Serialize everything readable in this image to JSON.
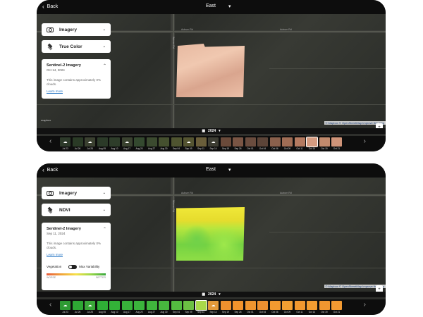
{
  "panels": [
    {
      "back_label": "Back",
      "field_name": "East",
      "imagery_label": "Imagery",
      "layer_label": "True Color",
      "info": {
        "title": "Sentinel-2 Imagery",
        "date": "Oct 14, 2024",
        "message": "This image contains approximately 0% clouds.",
        "link": "Learn more"
      },
      "road_labels": {
        "v": "Warren Rd",
        "h": "Auburn Rd",
        "h2": "Auburn Rd"
      },
      "mapbox": "mapbox",
      "attribution": "© Mapbox © OpenStreetMap Improve this map",
      "year": "2024",
      "timeline": [
        {
          "label": "Jul 23",
          "color": "#2d3a2a",
          "icon": "cloud"
        },
        {
          "label": "Jul 26",
          "color": "#2a3a26",
          "icon": ""
        },
        {
          "label": "Jul 28",
          "color": "#3a4030",
          "icon": "cloud"
        },
        {
          "label": "Aug 05",
          "color": "#2b3a28",
          "icon": ""
        },
        {
          "label": "Aug 10",
          "color": "#2e3d2a",
          "icon": ""
        },
        {
          "label": "Aug 17",
          "color": "#3a4230",
          "icon": "cloud"
        },
        {
          "label": "Aug 20",
          "color": "#34492f",
          "icon": ""
        },
        {
          "label": "Aug 27",
          "color": "#3b4a2f",
          "icon": ""
        },
        {
          "label": "Aug 30",
          "color": "#45502f",
          "icon": ""
        },
        {
          "label": "Sep 04",
          "color": "#4f5430",
          "icon": ""
        },
        {
          "label": "Sep 09",
          "color": "#545431",
          "icon": "cloud"
        },
        {
          "label": "Sep 11",
          "color": "#6a5e3a",
          "icon": ""
        },
        {
          "label": "Sep 14",
          "color": "#3d3d33",
          "icon": "cloud"
        },
        {
          "label": "Sep 19",
          "color": "#6a4a3a",
          "icon": ""
        },
        {
          "label": "Sep 26",
          "color": "#7a5544",
          "icon": ""
        },
        {
          "label": "Oct 01",
          "color": "#6a4c3e",
          "icon": ""
        },
        {
          "label": "Oct 04",
          "color": "#5c4438",
          "icon": ""
        },
        {
          "label": "Oct 06",
          "color": "#8a604c",
          "icon": ""
        },
        {
          "label": "Oct 09",
          "color": "#a06d55",
          "icon": ""
        },
        {
          "label": "Oct 11",
          "color": "#b47a60",
          "icon": ""
        },
        {
          "label": "Oct 14",
          "color": "#d49b80",
          "icon": ""
        },
        {
          "label": "Oct 19",
          "color": "#c18a6d",
          "icon": ""
        },
        {
          "label": "Oct 21",
          "color": "#cf9479",
          "icon": ""
        }
      ],
      "selected": 20
    },
    {
      "back_label": "Back",
      "field_name": "East",
      "imagery_label": "Imagery",
      "layer_label": "NDVI",
      "info": {
        "title": "Sentinel-2 Imagery",
        "date": "Sep 11, 2024",
        "message": "This image contains approximately 0% clouds.",
        "link": "Learn more"
      },
      "vegetation": {
        "label": "Vegetation",
        "toggle_label": "Max Variability",
        "worse": "WORSE",
        "better": "BETTER"
      },
      "road_labels": {
        "v": "Warren Rd",
        "h": "Auburn Rd",
        "h2": "Auburn Rd"
      },
      "mapbox": "mapbox",
      "attribution": "© Mapbox © OpenStreetMap Improve this map",
      "year": "2024",
      "timeline": [
        {
          "label": "Jul 23",
          "color": "#2e9a33",
          "icon": "cloud"
        },
        {
          "label": "Jul 26",
          "color": "#2ea834",
          "icon": ""
        },
        {
          "label": "Jul 28",
          "color": "#3aa838",
          "icon": "cloud"
        },
        {
          "label": "Aug 05",
          "color": "#2fae36",
          "icon": ""
        },
        {
          "label": "Aug 10",
          "color": "#33b238",
          "icon": ""
        },
        {
          "label": "Aug 17",
          "color": "#38b23a",
          "icon": ""
        },
        {
          "label": "Aug 20",
          "color": "#3bb33c",
          "icon": ""
        },
        {
          "label": "Aug 27",
          "color": "#40b53d",
          "icon": ""
        },
        {
          "label": "Aug 30",
          "color": "#47b73e",
          "icon": ""
        },
        {
          "label": "Sep 04",
          "color": "#54bb40",
          "icon": ""
        },
        {
          "label": "Sep 09",
          "color": "#6bc043",
          "icon": ""
        },
        {
          "label": "Sep 11",
          "color": "#a9d94a",
          "icon": ""
        },
        {
          "label": "Sep 14",
          "color": "#e49a3a",
          "icon": "cloud"
        },
        {
          "label": "Sep 19",
          "color": "#f0902e",
          "icon": ""
        },
        {
          "label": "Sep 26",
          "color": "#f2932c",
          "icon": ""
        },
        {
          "label": "Oct 01",
          "color": "#f0952f",
          "icon": ""
        },
        {
          "label": "Oct 04",
          "color": "#ee9030",
          "icon": ""
        },
        {
          "label": "Oct 06",
          "color": "#f29a30",
          "icon": ""
        },
        {
          "label": "Oct 09",
          "color": "#f3a032",
          "icon": ""
        },
        {
          "label": "Oct 11",
          "color": "#f1982f",
          "icon": ""
        },
        {
          "label": "Oct 14",
          "color": "#f39d31",
          "icon": ""
        },
        {
          "label": "Oct 19",
          "color": "#f09630",
          "icon": ""
        },
        {
          "label": "Oct 21",
          "color": "#f29a32",
          "icon": ""
        }
      ],
      "selected": 11
    }
  ]
}
